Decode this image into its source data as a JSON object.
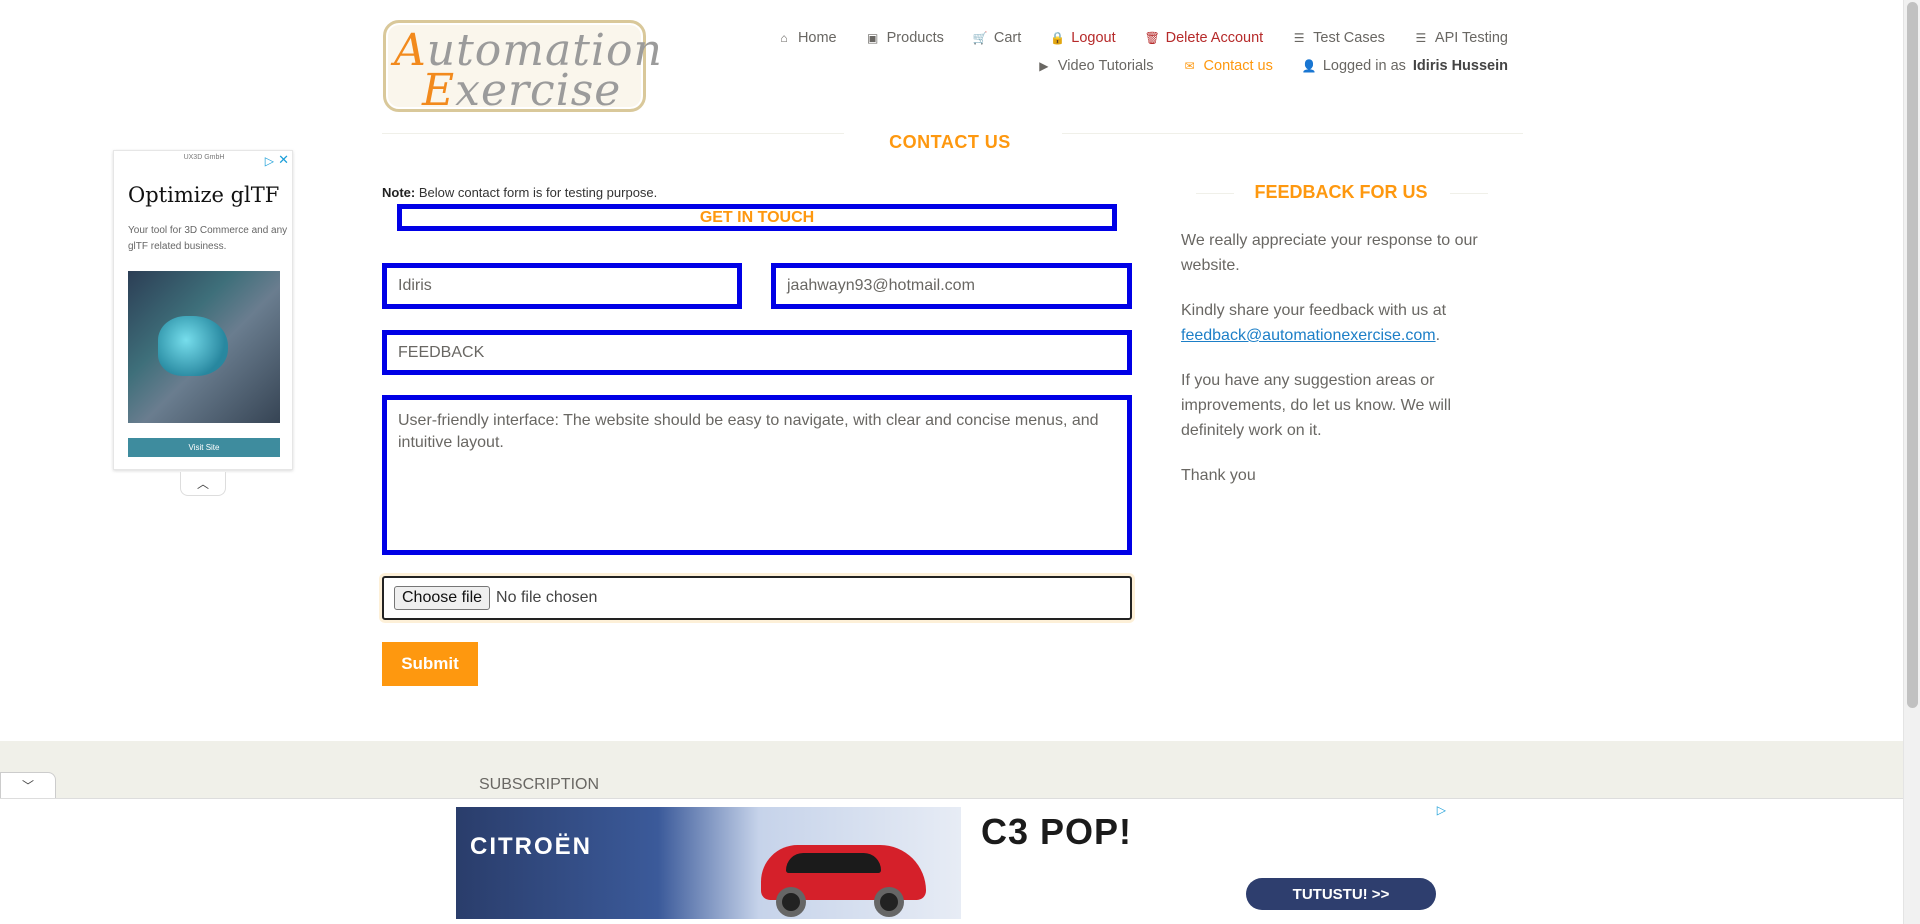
{
  "logo": {
    "line1_first": "A",
    "line1_rest": "utomation",
    "line2_first": "E",
    "line2_rest": "xercise"
  },
  "nav": {
    "row1": [
      {
        "icon": "home-icon",
        "glyph": "⌂",
        "label": "Home"
      },
      {
        "icon": "briefcase-icon",
        "glyph": "▣",
        "label": "Products"
      },
      {
        "icon": "cart-icon",
        "glyph": "🛒",
        "label": "Cart"
      },
      {
        "icon": "lock-icon",
        "glyph": "🔒",
        "label": "Logout"
      },
      {
        "icon": "trash-icon",
        "glyph": "🗑",
        "label": "Delete Account"
      },
      {
        "icon": "list-icon",
        "glyph": "☰",
        "label": "Test Cases"
      },
      {
        "icon": "list-icon",
        "glyph": "☰",
        "label": "API Testing"
      }
    ],
    "row2": [
      {
        "icon": "youtube-play-icon",
        "glyph": "▶",
        "label": "Video Tutorials"
      },
      {
        "icon": "envelope-icon",
        "glyph": "✉",
        "label": "Contact us"
      },
      {
        "icon": "user-icon",
        "glyph": "👤",
        "label": "Logged in as",
        "user": "Idiris Hussein"
      }
    ]
  },
  "contact": {
    "title": "CONTACT US",
    "note_label": "Note:",
    "note_text": " Below contact form is for testing purpose.",
    "get_in_touch": "GET IN TOUCH",
    "name_value": "Idiris",
    "email_value": "jaahwayn93@hotmail.com",
    "subject_value": "FEEDBACK",
    "message_value": "User-friendly interface: The website should be easy to navigate, with clear and concise menus, and intuitive layout.",
    "file_button": "Choose file",
    "file_status": "No file chosen",
    "submit_label": "Submit"
  },
  "feedback": {
    "title": "FEEDBACK FOR US",
    "p1": "We really appreciate your response to our website.",
    "p2_before": "Kindly share your feedback with us at ",
    "p2_link": "feedback@automationexercise.com",
    "p2_after": ".",
    "p3": "If you have any suggestion areas or improvements, do let us know. We will definitely work on it.",
    "p4": "Thank you"
  },
  "ad_left": {
    "source": "UX3D GmbH",
    "headline": "Optimize glTF",
    "subtext": "Your tool for 3D Commerce and any glTF related business.",
    "cta": "Visit Site"
  },
  "footer": {
    "subscription": "SUBSCRIPTION"
  },
  "ad_bottom": {
    "brand": "CITROËN",
    "headline": "C3 POP!",
    "cta": "TUTUSTU! >>"
  },
  "colors": {
    "accent": "#fe980f",
    "highlight_border": "#0000e6",
    "link": "#1d7fc7",
    "danger": "#b62a2a"
  }
}
